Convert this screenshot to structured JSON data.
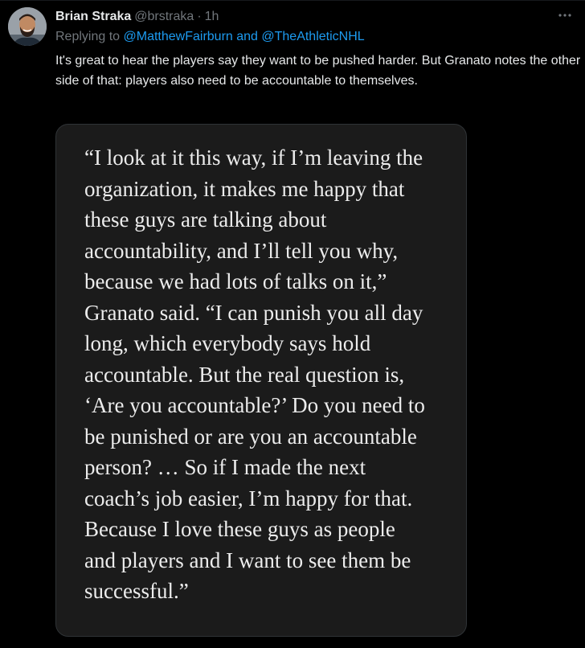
{
  "tweet": {
    "author_name": "Brian Straka",
    "author_handle": "@brstraka",
    "separator": "·",
    "timestamp": "1h",
    "more_icon": "more-dots-icon",
    "replying_to_prefix": "Replying to",
    "reply_mentions": "@MatthewFairburn and @TheAthleticNHL",
    "text": "It's great to hear the players say they want to be pushed harder. But Granato notes the other side of that: players also need to be accountable to themselves.",
    "media": {
      "quote": "“I look at it this way, if I’m leaving the\norganization, it makes me happy that\nthese guys are talking about\naccountability, and I’ll tell you why,\nbecause we had lots of talks on it,”\nGranato said. “I can punish you all day\nlong, which everybody says hold\naccountable. But the real question is,\n‘Are you accountable?’ Do you need to\nbe punished or are you an accountable\nperson? … So if I made the next\ncoach’s job easier, I’m happy for that.\nBecause I love these guys as people\nand players and I want to see them be\nsuccessful.”"
    }
  },
  "colors": {
    "background": "#000000",
    "text_primary": "#e7e9ea",
    "text_secondary": "#71767b",
    "link": "#1d9bf0",
    "card_background": "#1b1b1b",
    "card_border": "#2f3336",
    "quote_text": "#ececec"
  }
}
